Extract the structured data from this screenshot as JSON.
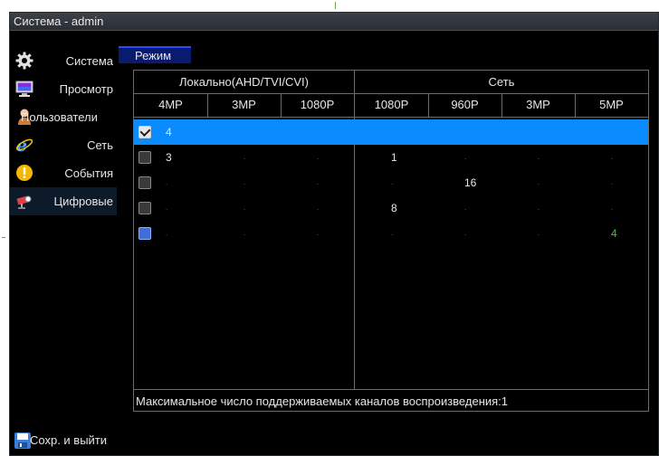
{
  "window": {
    "title": "Система - admin"
  },
  "sidebar": {
    "items": [
      {
        "label": "Система",
        "icon": "gear-icon"
      },
      {
        "label": "Просмотр",
        "icon": "monitor-icon"
      },
      {
        "label": "Пользователи",
        "icon": "user-icon"
      },
      {
        "label": "Сеть",
        "icon": "internet-icon"
      },
      {
        "label": "События",
        "icon": "warning-icon"
      },
      {
        "label": "Цифровые",
        "icon": "camera-icon"
      }
    ],
    "active_index": 5
  },
  "tab": {
    "label": "Режим"
  },
  "table": {
    "groups": [
      "Локально(AHD/TVI/CVI)",
      "Сеть"
    ],
    "columns": [
      "4MP",
      "3MP",
      "1080P",
      "1080P",
      "960P",
      "3MP",
      "5MP"
    ],
    "rows": [
      {
        "checked": true,
        "selected": true,
        "cells": [
          "4",
          ".",
          ".",
          ".",
          ".",
          ".",
          "."
        ]
      },
      {
        "checked": false,
        "selected": false,
        "cells": [
          "3",
          ".",
          ".",
          "1",
          ".",
          ".",
          "."
        ]
      },
      {
        "checked": false,
        "selected": false,
        "cells": [
          ".",
          ".",
          ".",
          ".",
          "16",
          ".",
          "."
        ]
      },
      {
        "checked": false,
        "selected": false,
        "cells": [
          ".",
          ".",
          ".",
          "8",
          ".",
          ".",
          "."
        ]
      },
      {
        "checked": false,
        "selected": false,
        "cells": [
          ".",
          ".",
          ".",
          ".",
          ".",
          ".",
          "4"
        ]
      }
    ],
    "footer": "Максимальное число поддерживаемых каналов воспроизведения:1"
  },
  "save_button": {
    "label": "Сохр. и выйти",
    "icon": "floppy-disk-icon"
  },
  "colors": {
    "accent_blue": "#0a8cff",
    "tab_blue": "#0a1a6e",
    "highlight_green": "#2fd02f"
  }
}
